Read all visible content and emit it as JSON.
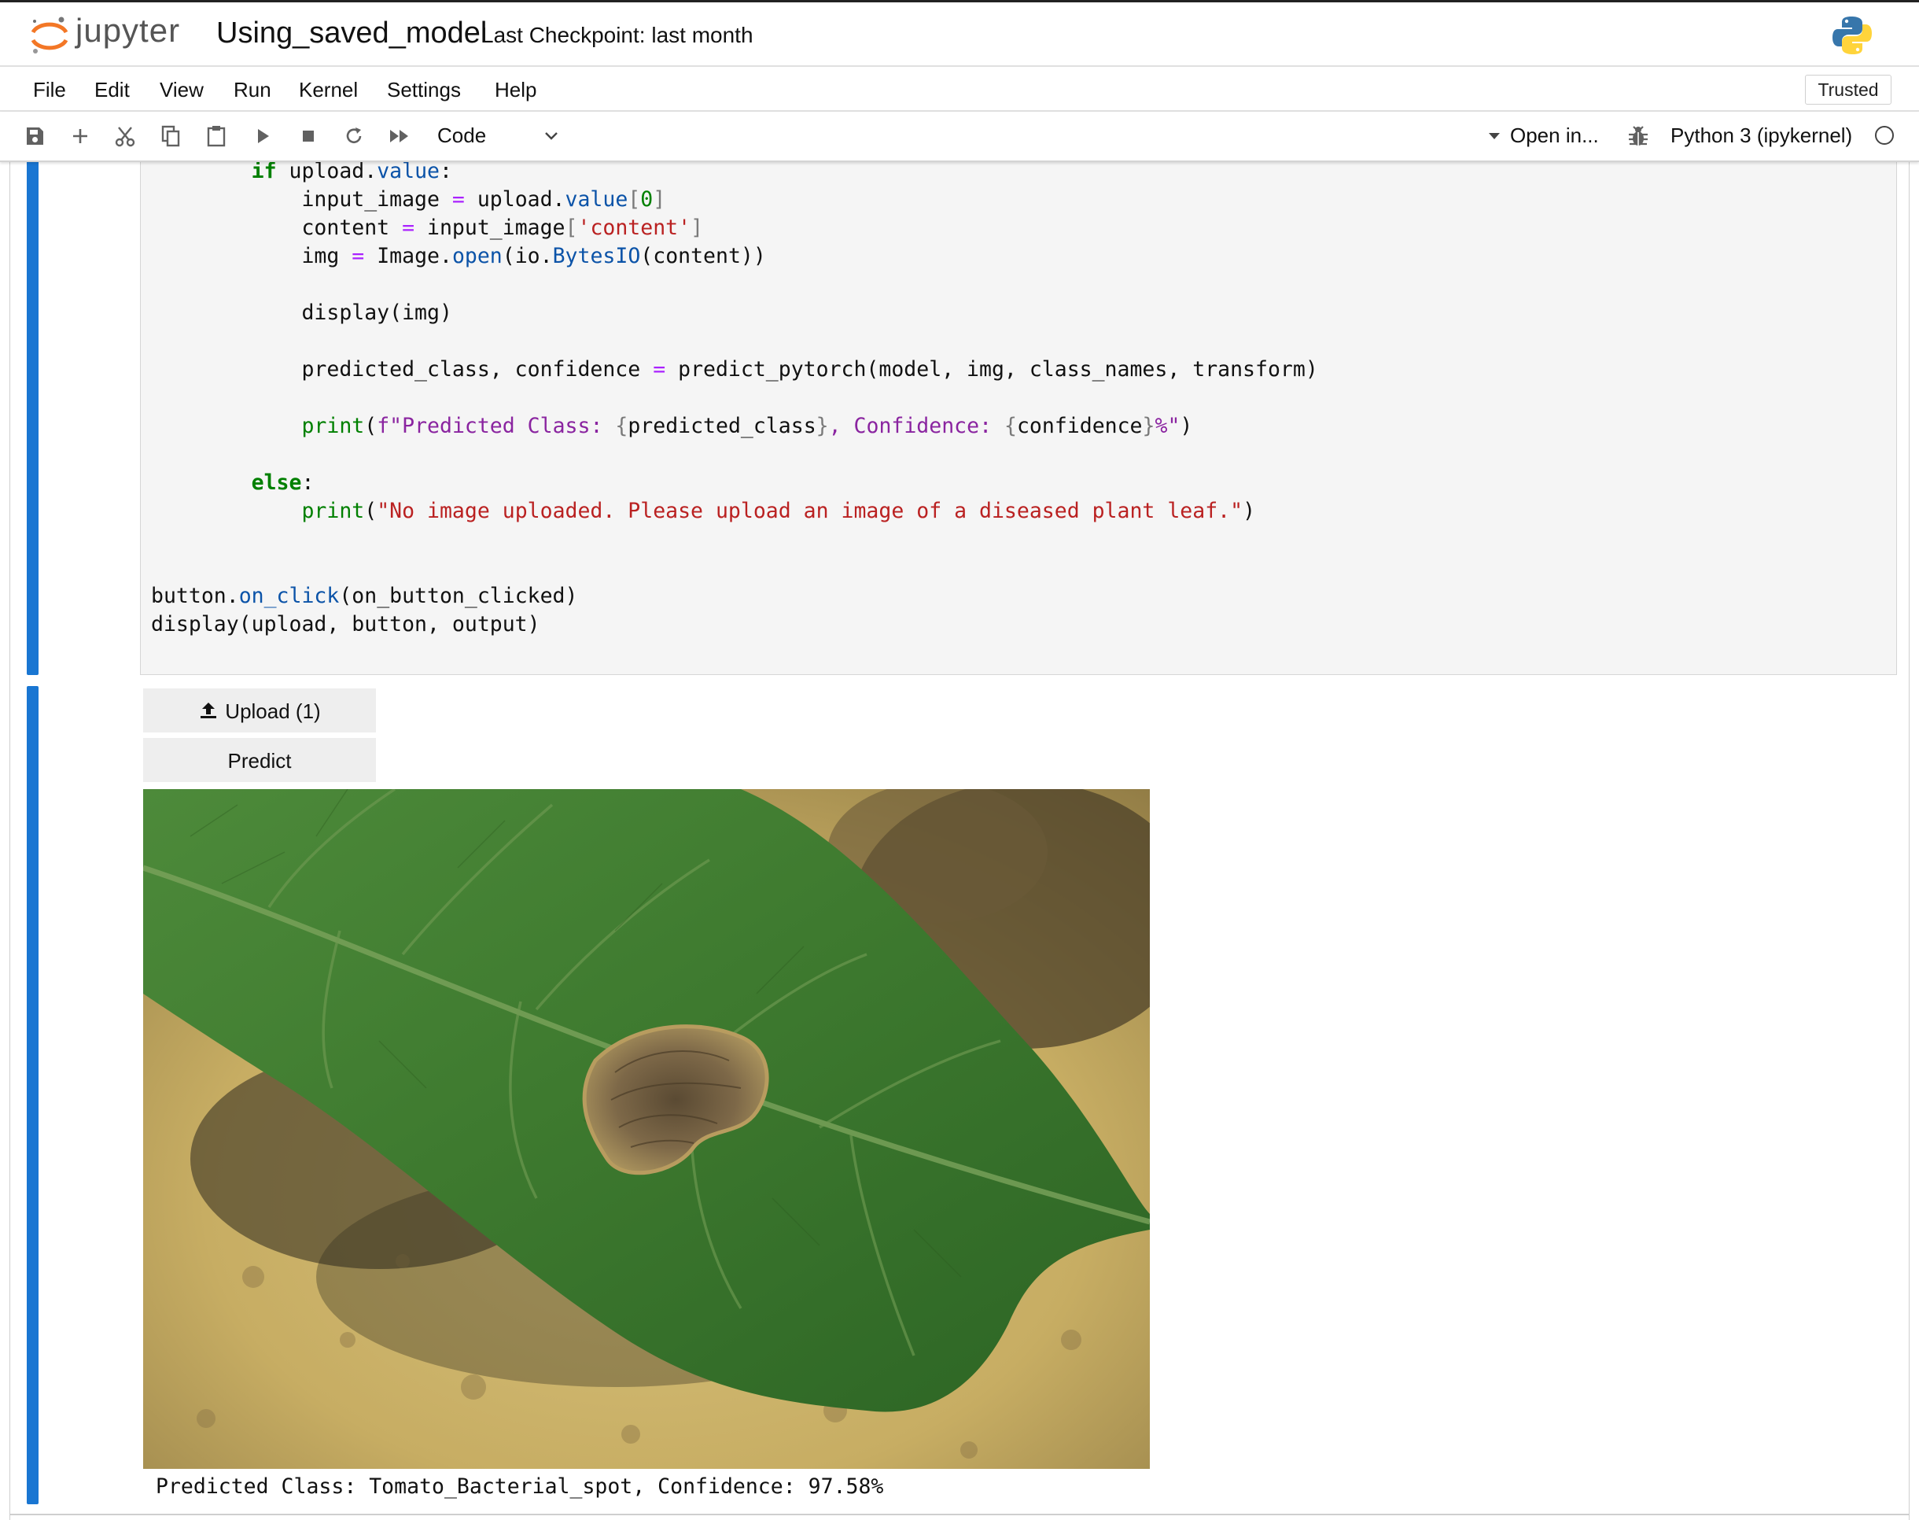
{
  "header": {
    "logo_text": "jupyter",
    "notebook_title": "Using_saved_model",
    "checkpoint": "Last Checkpoint: last month"
  },
  "menu": {
    "items": [
      "File",
      "Edit",
      "View",
      "Run",
      "Kernel",
      "Settings",
      "Help"
    ],
    "trusted": "Trusted"
  },
  "toolbar": {
    "cell_type": "Code",
    "open_in": "Open in...",
    "kernel": "Python 3 (ipykernel)",
    "buttons": [
      "save-icon",
      "plus-icon",
      "scissors-icon",
      "copy-icon",
      "paste-icon",
      "play-icon",
      "stop-icon",
      "restart-icon",
      "fast-forward-icon"
    ]
  },
  "code_cell": {
    "lines": [
      "        if upload.value:",
      "            input_image = upload.value[0]",
      "            content = input_image['content']",
      "            img = Image.open(io.BytesIO(content))",
      "",
      "            display(img)",
      "",
      "            predicted_class, confidence = predict_pytorch(model, img, class_names, transform)",
      "",
      "            print(f\"Predicted Class: {predicted_class}, Confidence: {confidence}%\")",
      "",
      "        else:",
      "            print(\"No image uploaded. Please upload an image of a diseased plant leaf.\")",
      "",
      "",
      "button.on_click(on_button_clicked)",
      "display(upload, button, output)"
    ]
  },
  "output": {
    "upload_label": "Upload (1)",
    "predict_label": "Predict",
    "result_text": "Predicted Class: Tomato_Bacterial_spot, Confidence: 97.58%"
  },
  "colors": {
    "cell_bar": "#1976d2",
    "keyword": "#008000",
    "string": "#ba2121",
    "attribute": "#0b53a8",
    "operator": "#aa22ff"
  }
}
